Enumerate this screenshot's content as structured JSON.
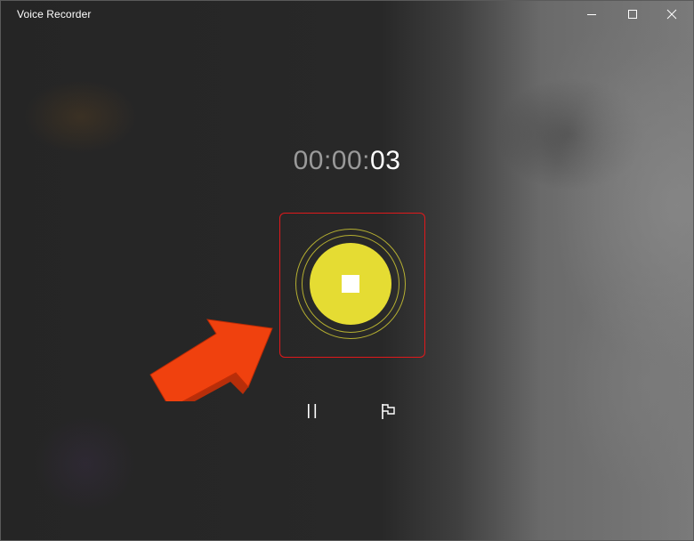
{
  "window": {
    "title": "Voice Recorder",
    "controls": {
      "minimize": "minimize-icon",
      "maximize": "maximize-icon",
      "close": "close-icon"
    }
  },
  "timer": {
    "elapsed_dim": "00:00:",
    "elapsed_seconds": "03"
  },
  "recorder": {
    "stop_icon": "stop-icon",
    "accent_color": "#e5dc33",
    "highlight_color": "#e0191b",
    "annotation_arrow_color": "#f0410e"
  },
  "controls": {
    "pause_icon": "pause-icon",
    "marker_icon": "flag-icon"
  }
}
